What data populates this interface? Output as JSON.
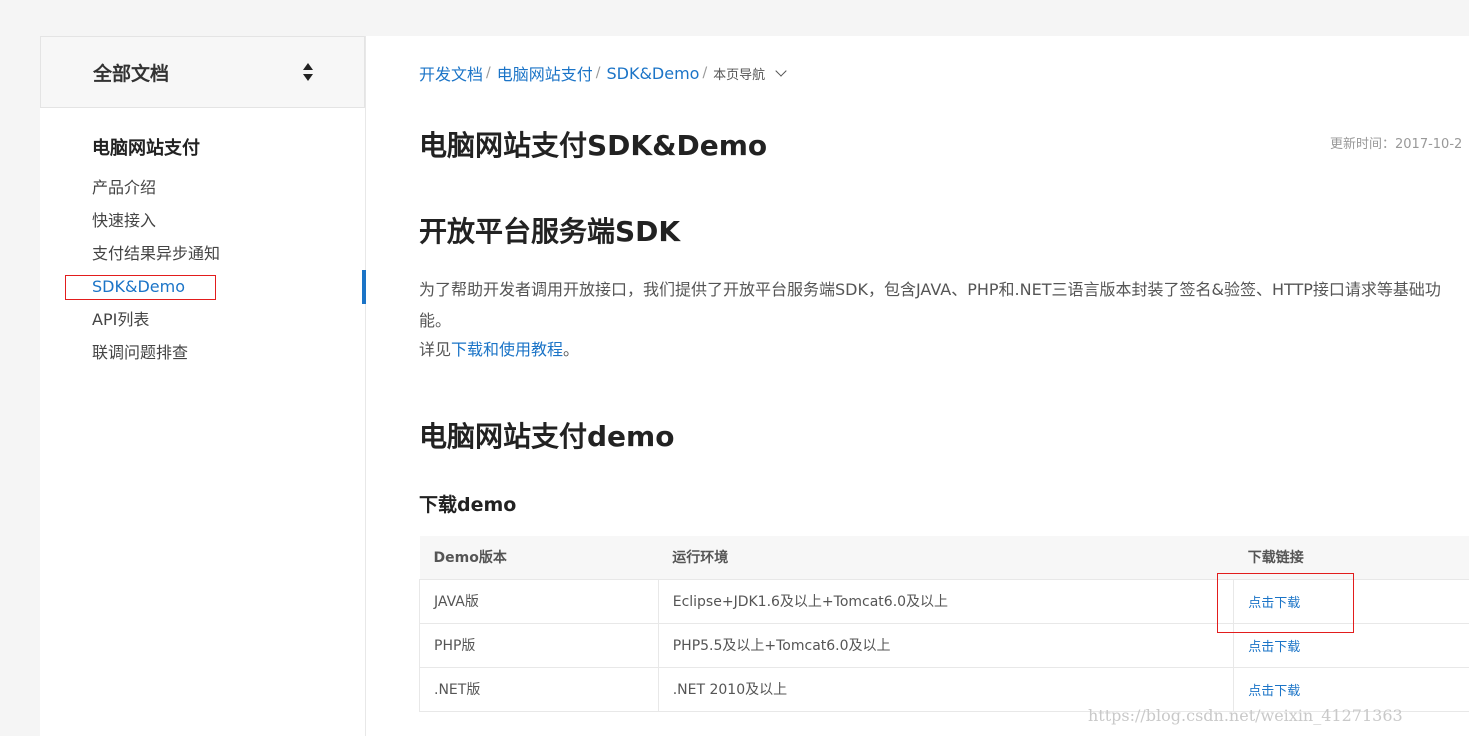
{
  "sidebar": {
    "header_title": "全部文档",
    "group_title": "电脑网站支付",
    "items": [
      {
        "label": "产品介绍"
      },
      {
        "label": "快速接入"
      },
      {
        "label": "支付结果异步通知"
      },
      {
        "label": "SDK&Demo"
      },
      {
        "label": "API列表"
      },
      {
        "label": "联调问题排查"
      }
    ]
  },
  "breadcrumb": {
    "items": [
      "开发文档",
      "电脑网站支付",
      "SDK&Demo"
    ],
    "page_nav": "本页导航"
  },
  "main": {
    "title": "电脑网站支付SDK&Demo",
    "update_time": "更新时间：2017-10-2",
    "sdk_heading": "开放平台服务端SDK",
    "sdk_desc": "为了帮助开发者调用开放接口，我们提供了开放平台服务端SDK，包含JAVA、PHP和.NET三语言版本封装了签名&验签、HTTP接口请求等基础功能。",
    "see_prefix": "详见",
    "see_link": "下载和使用教程",
    "see_suffix": "。",
    "demo_heading": "电脑网站支付demo",
    "download_heading": "下载demo"
  },
  "table": {
    "headers": [
      "Demo版本",
      "运行环境",
      "下载链接"
    ],
    "rows": [
      {
        "version": "JAVA版",
        "env": "Eclipse+JDK1.6及以上+Tomcat6.0及以上",
        "link": "点击下载"
      },
      {
        "version": "PHP版",
        "env": "PHP5.5及以上+Tomcat6.0及以上",
        "link": "点击下载"
      },
      {
        "version": ".NET版",
        "env": ".NET 2010及以上",
        "link": "点击下载"
      }
    ]
  },
  "watermark": "https://blog.csdn.net/weixin_41271363",
  "colors": {
    "accent": "#1b74c7",
    "annotation": "#e21d1d"
  }
}
